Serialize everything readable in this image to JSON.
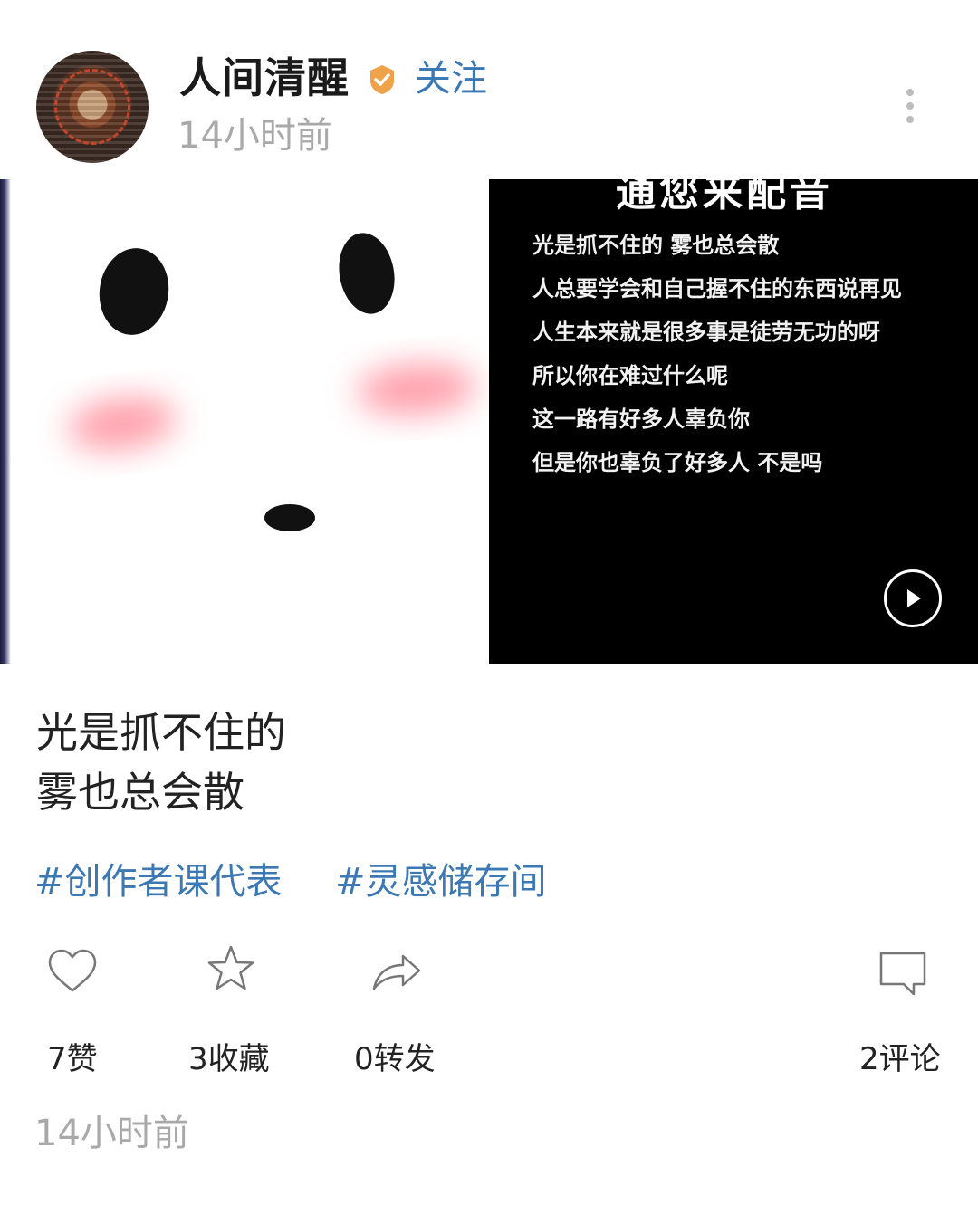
{
  "header": {
    "username": "人间清醒",
    "follow_label": "关注",
    "time_ago": "14小时前",
    "verified_icon": "verified-badge-icon",
    "more_icon": "more-vertical-icon",
    "verified_color": "#f0a24a"
  },
  "media": {
    "left_image": "panda-face-illustration",
    "video_title": "通您来配音",
    "lyrics": [
      "光是抓不住的  雾也总会散",
      "人总要学会和自己握不住的东西说再见",
      "人生本来就是很多事是徒劳无功的呀",
      "所以你在难过什么呢",
      "这一路有好多人辜负你",
      "但是你也辜负了好多人  不是吗"
    ],
    "play_icon": "play-icon"
  },
  "post": {
    "caption_lines": [
      "光是抓不住的",
      "雾也总会散"
    ],
    "tags": [
      "#创作者课代表",
      "#灵感储存间"
    ]
  },
  "actions": {
    "like_label": "7赞",
    "favorite_label": "3收藏",
    "repost_label": "0转发",
    "comment_label": "2评论"
  },
  "footer": {
    "time_ago": "14小时前"
  },
  "colors": {
    "link": "#3b78b4",
    "muted": "#a9a9a9"
  }
}
